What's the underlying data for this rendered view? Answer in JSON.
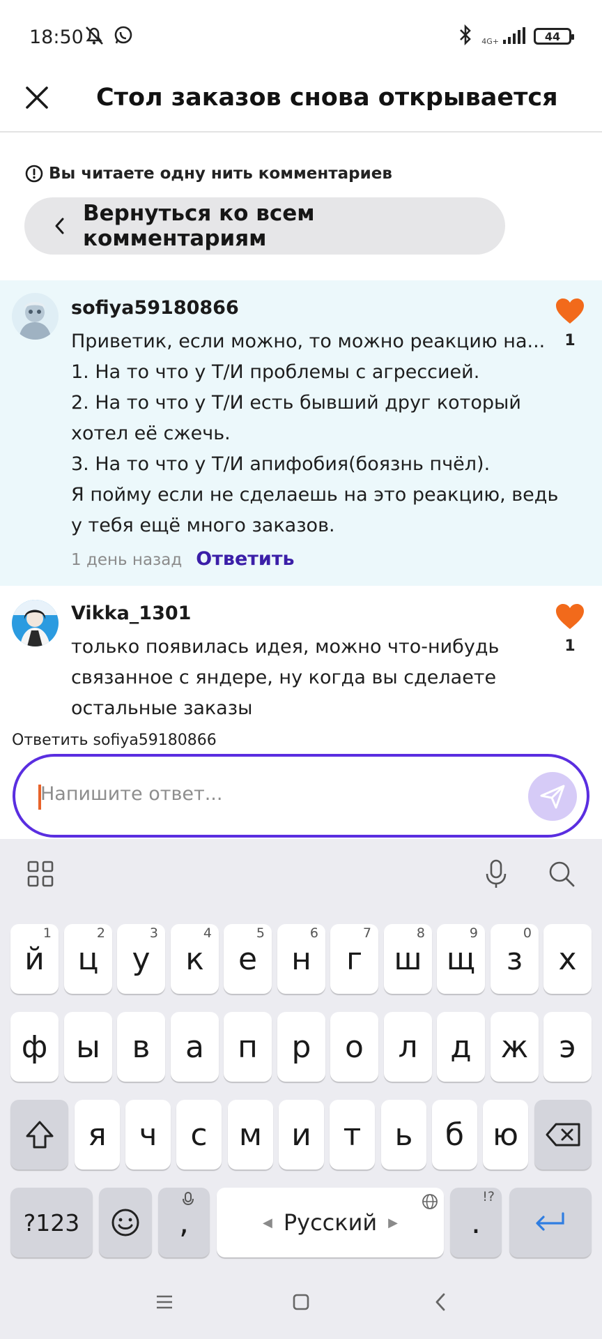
{
  "status_bar": {
    "time": "18:50",
    "network": "4G+",
    "battery": "44",
    "icons": [
      "do-not-disturb-icon",
      "whatsapp-icon",
      "bluetooth-icon",
      "signal-icon",
      "battery-icon"
    ]
  },
  "header": {
    "title": "Стол заказов снова открывается",
    "close_icon": "close-icon"
  },
  "thread": {
    "notice": "Вы читаете одну нить комментариев",
    "back_label": "Вернуться ко всем комментариям"
  },
  "comments": [
    {
      "user": "sofiya59180866",
      "lines": [
        "Приветик, если можно, то можно реакцию на...",
        "1. На то что у Т/И проблемы с агрессией.",
        "2. На то что у Т/И есть бывший друг который",
        "хотел её сжечь.",
        "3. На то что у Т/И апифобия(боязнь пчёл).",
        "Я пойму если не сделаешь на это реакцию, ведь",
        "у тебя ещё много заказов."
      ],
      "likes": "1",
      "time": "1 день назад",
      "reply_label": "Ответить"
    },
    {
      "user": "Vikka_1301",
      "lines": [
        "только появилась идея, можно что-нибудь",
        "связанное с яндере, ну когда вы сделаете",
        "остальные заказы"
      ],
      "likes": "1"
    }
  ],
  "reply": {
    "to_label": "Ответить sofiya59180866",
    "placeholder": "Напишите ответ..."
  },
  "keyboard": {
    "row1": [
      {
        "k": "й",
        "h": "1"
      },
      {
        "k": "ц",
        "h": "2"
      },
      {
        "k": "у",
        "h": "3"
      },
      {
        "k": "к",
        "h": "4"
      },
      {
        "k": "е",
        "h": "5"
      },
      {
        "k": "н",
        "h": "6"
      },
      {
        "k": "г",
        "h": "7"
      },
      {
        "k": "ш",
        "h": "8"
      },
      {
        "k": "щ",
        "h": "9"
      },
      {
        "k": "з",
        "h": "0"
      },
      {
        "k": "х",
        "h": ""
      }
    ],
    "row2": [
      "ф",
      "ы",
      "в",
      "а",
      "п",
      "р",
      "о",
      "л",
      "д",
      "ж",
      "э"
    ],
    "row3": [
      "я",
      "ч",
      "с",
      "м",
      "и",
      "т",
      "ь",
      "б",
      "ю"
    ],
    "symbols": "?123",
    "comma": ",",
    "space": "Русский",
    "period": ".",
    "period_hint": "!?"
  },
  "colors": {
    "accent": "#5a2ee0",
    "reply_link": "#3b1fa8",
    "like": "#f26a1b",
    "highlight_bg": "#ecf8fb",
    "enter_key": "#2f7de1"
  }
}
